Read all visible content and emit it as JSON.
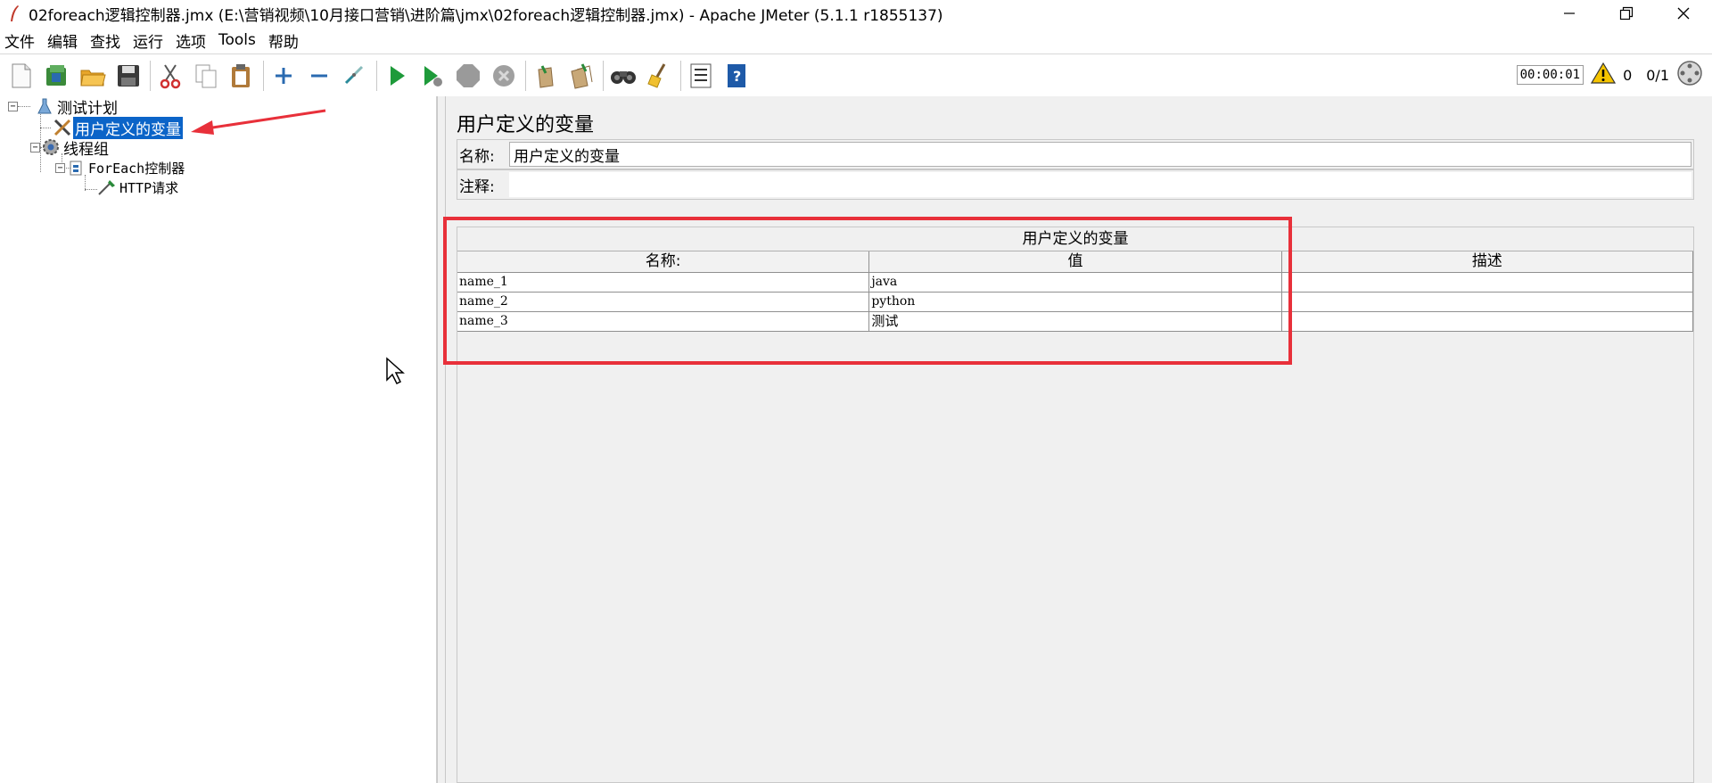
{
  "window": {
    "title": "02foreach逻辑控制器.jmx (E:\\营销视频\\10月接口营销\\进阶篇\\jmx\\02foreach逻辑控制器.jmx) - Apache JMeter (5.1.1 r1855137)"
  },
  "menu": {
    "items": [
      "文件",
      "编辑",
      "查找",
      "运行",
      "选项",
      "Tools",
      "帮助"
    ]
  },
  "toolbar": {
    "timer": "00:00:01",
    "warning_count": "0",
    "threads": "0/1"
  },
  "tree": {
    "test_plan": "测试计划",
    "udv": "用户定义的变量",
    "thread_group": "线程组",
    "foreach": "ForEach控制器",
    "http": "HTTP请求"
  },
  "panel": {
    "title": "用户定义的变量",
    "name_label": "名称:",
    "name_value": "用户定义的变量",
    "comment_label": "注释:",
    "comment_value": ""
  },
  "table": {
    "caption": "用户定义的变量",
    "headers": [
      "名称:",
      "值",
      "描述"
    ],
    "rows": [
      [
        "name_1",
        "java",
        ""
      ],
      [
        "name_2",
        "python",
        ""
      ],
      [
        "name_3",
        "测试",
        ""
      ]
    ]
  },
  "colors": {
    "selection": "#0b64c8",
    "annotation_red": "#e8303a",
    "panel_bg": "#f0f0f0"
  }
}
